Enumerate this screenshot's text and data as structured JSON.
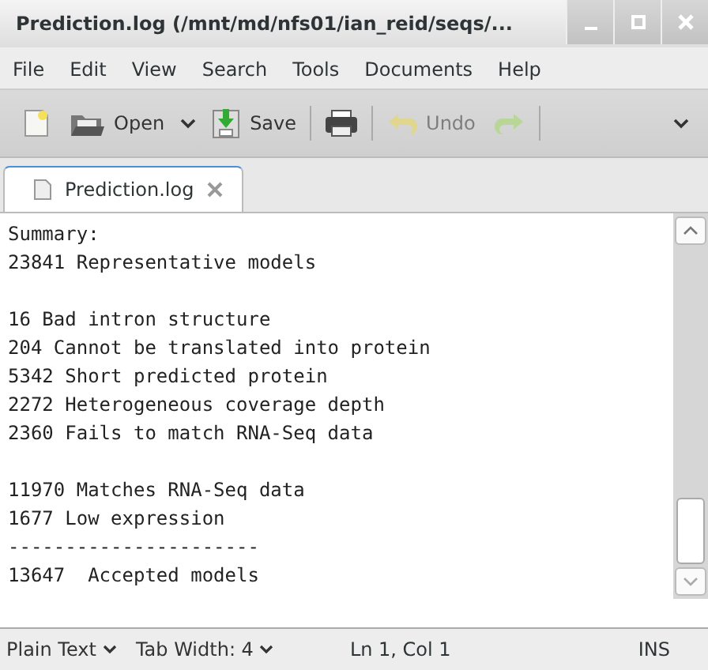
{
  "window": {
    "title": "Prediction.log (/mnt/md/nfs01/ian_reid/seqs/..."
  },
  "menu": [
    "File",
    "Edit",
    "View",
    "Search",
    "Tools",
    "Documents",
    "Help"
  ],
  "toolbar": [
    {
      "kind": "new"
    },
    {
      "kind": "open",
      "label": "Open"
    },
    {
      "kind": "save",
      "label": "Save"
    },
    {
      "kind": "print"
    },
    {
      "kind": "undo",
      "label": "Undo",
      "disabled": true
    },
    {
      "kind": "redo",
      "disabled": true
    }
  ],
  "tabs": [
    {
      "label": "Prediction.log",
      "selected": true
    }
  ],
  "blocks": [
    [
      "Summary:",
      "23841 Representative models"
    ],
    [
      "16 Bad intron structure",
      "204 Cannot be translated into protein",
      "5342 Short predicted protein",
      "2272 Heterogeneous coverage depth",
      "2360 Fails to match RNA-Seq data"
    ],
    [
      "11970 Matches RNA-Seq data",
      "1677 Low expression",
      "----------------------",
      "13647  Accepted models"
    ]
  ],
  "status_bar": {
    "language": "Plain Text",
    "tab_width": "Tab Width: 4",
    "position": "Ln 1, Col 1",
    "mode": "INS"
  }
}
